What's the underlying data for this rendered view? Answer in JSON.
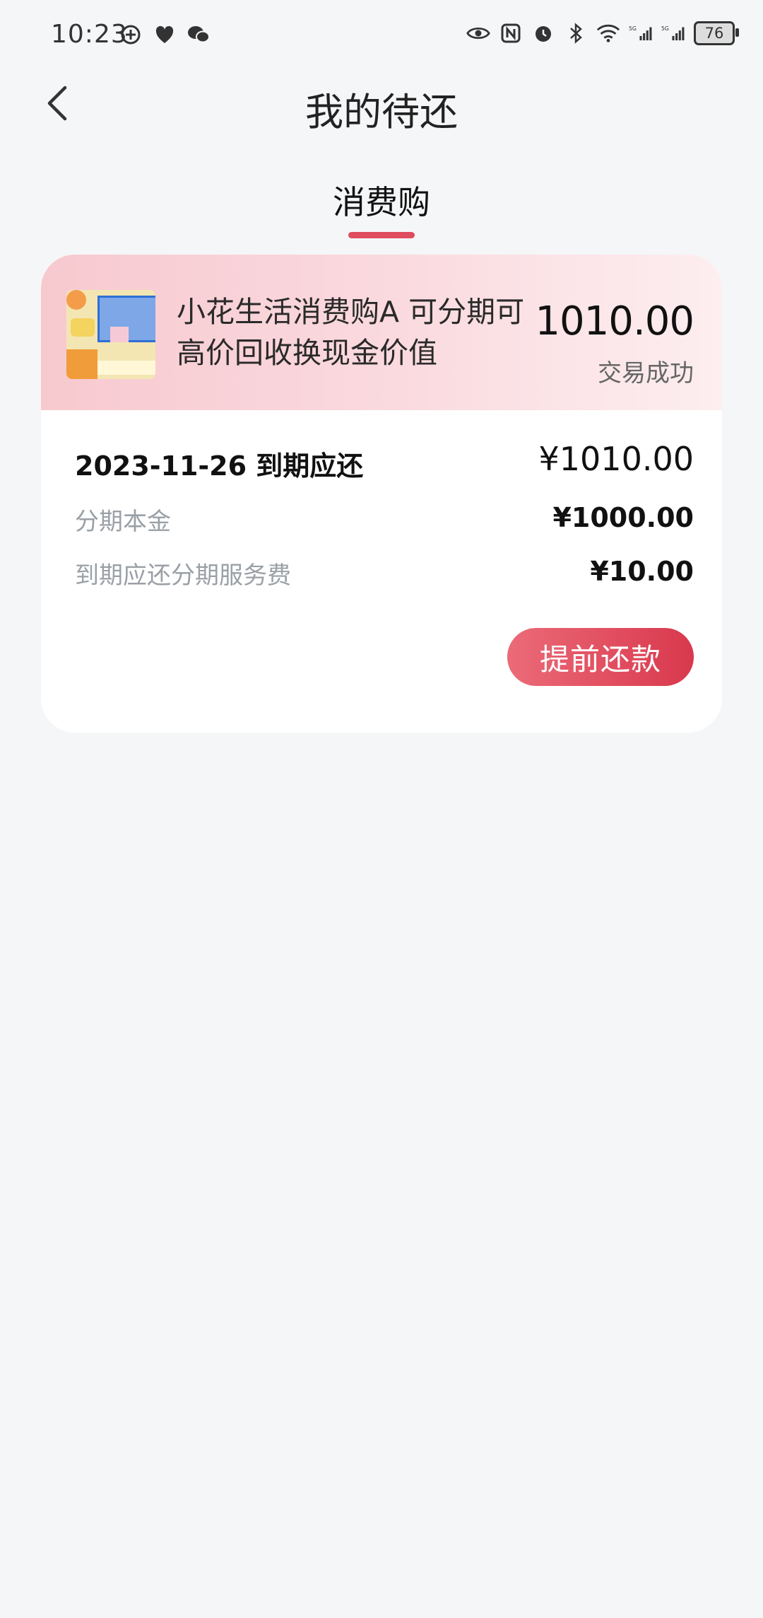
{
  "status_bar": {
    "time": "10:23",
    "battery": "76",
    "signal_1": "5G",
    "signal_2": "5G"
  },
  "header": {
    "title": "我的待还"
  },
  "tabs": [
    {
      "label": "消费购",
      "active": true
    }
  ],
  "order": {
    "product_title": "小花生活消费购A 可分期可高价回收换现金价值",
    "amount": "1010.00",
    "status": "交易成功",
    "due_label": "2023-11-26 到期应还",
    "due_amount": "¥1010.00",
    "principal_label": "分期本金",
    "principal_value": "¥1000.00",
    "fee_label": "到期应还分期服务费",
    "fee_value": "¥10.00",
    "repay_button": "提前还款"
  },
  "colors": {
    "accent": "#e04b5e",
    "button_start": "#eb6b78",
    "button_end": "#d9384d",
    "card_header": "#f7c9cf"
  }
}
